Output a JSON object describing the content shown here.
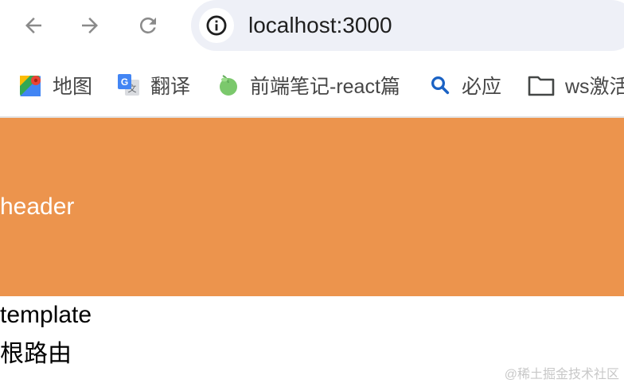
{
  "toolbar": {
    "back_icon": "arrow-left-icon",
    "forward_icon": "arrow-right-icon",
    "reload_icon": "reload-icon",
    "site_info_icon": "info-icon",
    "url": "localhost:3000"
  },
  "bookmarks": [
    {
      "label": "地图",
      "icon": "google-maps-icon"
    },
    {
      "label": "翻译",
      "icon": "google-translate-icon"
    },
    {
      "label": "前端笔记-react篇",
      "icon": "leaf-icon"
    },
    {
      "label": "必应",
      "icon": "search-icon"
    },
    {
      "label": "ws激活",
      "icon": "folder-icon"
    }
  ],
  "page": {
    "header": "header",
    "template": "template",
    "root_route": "根路由"
  },
  "watermark": "@稀土掘金技术社区",
  "colors": {
    "header_bg": "#ec944d",
    "omnibox_bg": "#eef0f7",
    "nav_icon": "#8a8a8a"
  }
}
